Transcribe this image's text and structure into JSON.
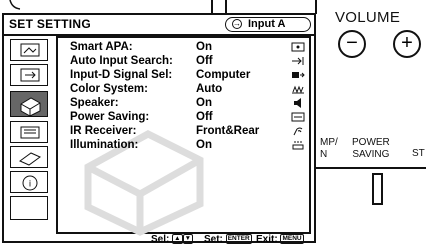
{
  "device": {
    "volume_label": "VOLUME",
    "volume_minus": "−",
    "volume_plus": "+",
    "lamp_label": "MP/\nN",
    "power_saving_label": "POWER\nSAVING",
    "st_label": "ST"
  },
  "menu": {
    "title": "SET SETTING",
    "input_badge": "Input A",
    "rows": [
      {
        "label": "Smart APA:",
        "value": "On",
        "icon": "apa-icon"
      },
      {
        "label": "Auto Input Search:",
        "value": "Off",
        "icon": "input-search-icon"
      },
      {
        "label": "Input-D Signal Sel:",
        "value": "Computer",
        "icon": "signal-select-icon"
      },
      {
        "label": "Color System:",
        "value": "Auto",
        "icon": "color-system-icon"
      },
      {
        "label": "Speaker:",
        "value": "On",
        "icon": "speaker-icon"
      },
      {
        "label": "Power Saving:",
        "value": "Off",
        "icon": "power-saving-icon"
      },
      {
        "label": "IR Receiver:",
        "value": "Front&Rear",
        "icon": "ir-receiver-icon"
      },
      {
        "label": "Illumination:",
        "value": "On",
        "icon": "illumination-icon"
      }
    ],
    "footer": {
      "sel_label": "Sel:",
      "set_label": "Set:",
      "set_key": "ENTER",
      "exit_label": "Exit:",
      "exit_key": "MENU"
    }
  }
}
